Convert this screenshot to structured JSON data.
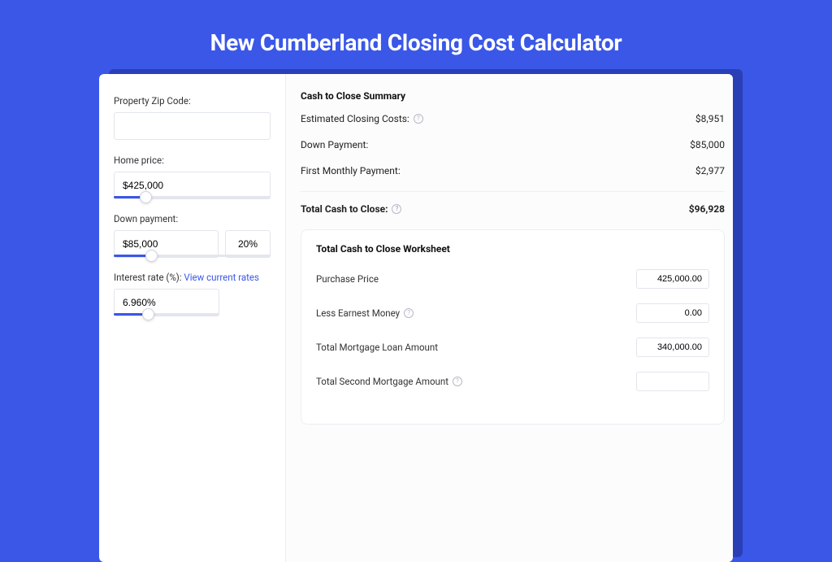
{
  "header": {
    "title": "New Cumberland Closing Cost Calculator"
  },
  "form": {
    "zip_label": "Property Zip Code:",
    "zip_value": "",
    "home_price_label": "Home price:",
    "home_price_value": "$425,000",
    "home_price_slider_pct": 20,
    "down_payment_label": "Down payment:",
    "down_payment_value": "$85,000",
    "down_payment_pct": "20%",
    "down_payment_slider_pct": 24,
    "rate_label": "Interest rate (%): ",
    "rate_link": "View current rates",
    "rate_value": "6.960%",
    "rate_slider_pct": 32
  },
  "summary": {
    "title": "Cash to Close Summary",
    "rows": [
      {
        "label": "Estimated Closing Costs:",
        "help": true,
        "value": "$8,951"
      },
      {
        "label": "Down Payment:",
        "help": false,
        "value": "$85,000"
      },
      {
        "label": "First Monthly Payment:",
        "help": false,
        "value": "$2,977"
      }
    ],
    "total": {
      "label": "Total Cash to Close:",
      "help": true,
      "value": "$96,928"
    }
  },
  "worksheet": {
    "title": "Total Cash to Close Worksheet",
    "rows": [
      {
        "label": "Purchase Price",
        "help": false,
        "value": "425,000.00"
      },
      {
        "label": "Less Earnest Money",
        "help": true,
        "value": "0.00"
      },
      {
        "label": "Total Mortgage Loan Amount",
        "help": false,
        "value": "340,000.00"
      },
      {
        "label": "Total Second Mortgage Amount",
        "help": true,
        "value": ""
      }
    ]
  }
}
